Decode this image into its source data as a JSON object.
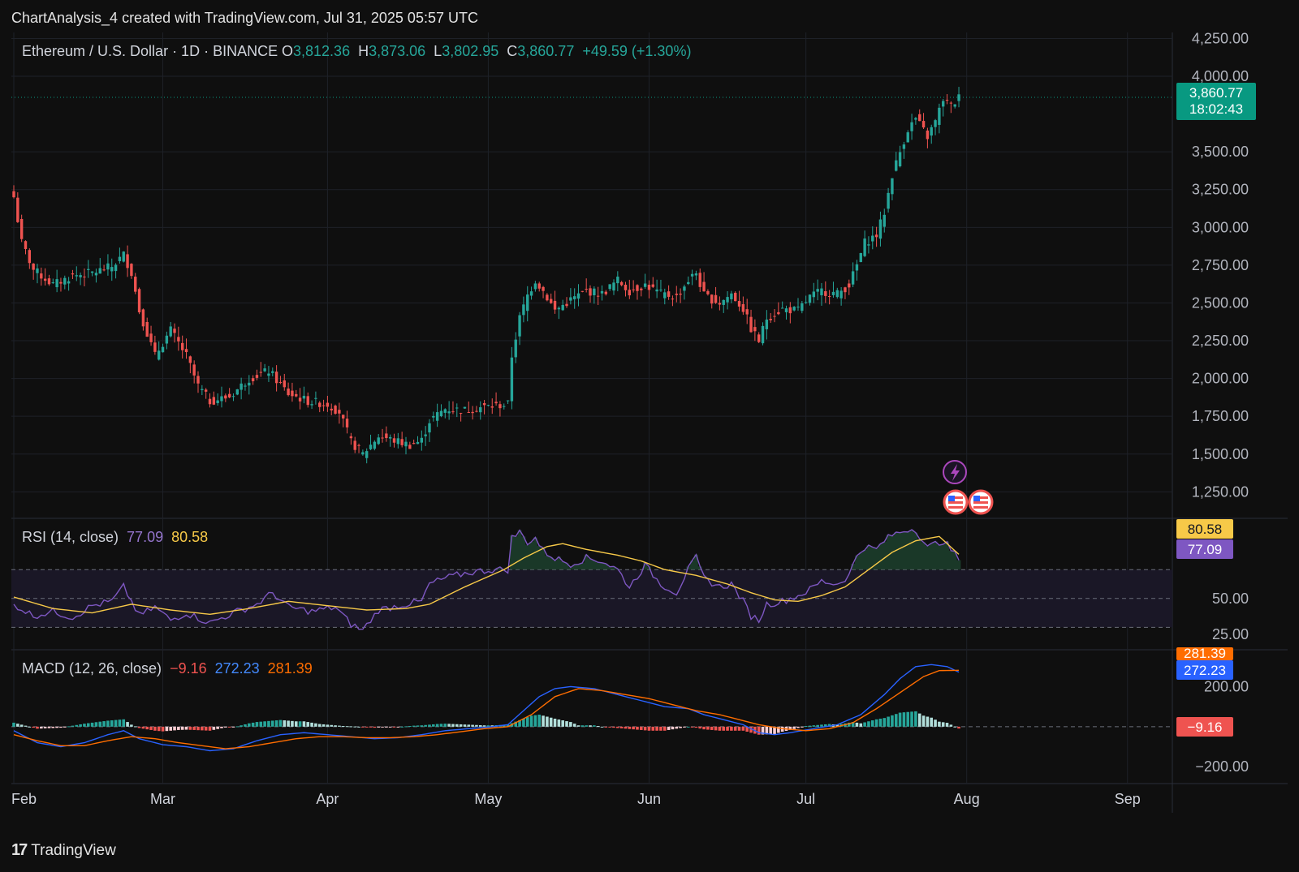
{
  "header": {
    "caption": "ChartAnalysis_4 created with TradingView.com, Jul 31, 2025 05:57 UTC"
  },
  "legend": {
    "symbol": "Ethereum / U.S. Dollar · 1D · BINANCE",
    "o_label": "O",
    "o_value": "3,812.36",
    "h_label": "H",
    "h_value": "3,873.06",
    "l_label": "L",
    "l_value": "3,802.95",
    "c_label": "C",
    "c_value": "3,860.77",
    "change": "+49.59 (+1.30%)"
  },
  "price_tag": {
    "price": "3,860.77",
    "countdown": "18:02:43"
  },
  "rsi": {
    "title": "RSI (14, close)",
    "value": "77.09",
    "ma_value": "80.58"
  },
  "macd": {
    "title": "MACD (12, 26, close)",
    "hist_value": "−9.16",
    "macd_value": "272.23",
    "signal_value": "281.39"
  },
  "footer": {
    "brand": "TradingView"
  },
  "colors": {
    "up": "#26a69a",
    "down": "#ef5350",
    "rsi_line": "#7e57c2",
    "rsi_ma": "#f7c948",
    "macd_line": "#2962ff",
    "signal_line": "#ff6d00",
    "tag_green": "#089981"
  },
  "chart_data": [
    {
      "type": "candlestick",
      "title": "Ethereum / U.S. Dollar · 1D · BINANCE",
      "x_ticks": [
        "Feb",
        "Mar",
        "Apr",
        "May",
        "Jun",
        "Jul",
        "Aug",
        "Sep"
      ],
      "y_ticks": [
        "1,250.00",
        "1,500.00",
        "1,750.00",
        "2,000.00",
        "2,250.00",
        "2,500.00",
        "2,750.00",
        "3,000.00",
        "3,250.00",
        "3,500.00",
        "4,000.00",
        "4,250.00"
      ],
      "ylim": [
        1080,
        4290
      ],
      "last_close": 3860.77,
      "anchors": [
        [
          0,
          3200
        ],
        [
          2,
          2900
        ],
        [
          5,
          2720
        ],
        [
          10,
          2620
        ],
        [
          15,
          2680
        ],
        [
          20,
          2700
        ],
        [
          25,
          2740
        ],
        [
          28,
          2820
        ],
        [
          30,
          2700
        ],
        [
          32,
          2450
        ],
        [
          36,
          2150
        ],
        [
          40,
          2320
        ],
        [
          44,
          2150
        ],
        [
          47,
          1950
        ],
        [
          50,
          1850
        ],
        [
          55,
          1880
        ],
        [
          60,
          2000
        ],
        [
          65,
          2050
        ],
        [
          70,
          1900
        ],
        [
          75,
          1850
        ],
        [
          80,
          1830
        ],
        [
          83,
          1780
        ],
        [
          86,
          1580
        ],
        [
          89,
          1500
        ],
        [
          93,
          1620
        ],
        [
          97,
          1590
        ],
        [
          101,
          1560
        ],
        [
          104,
          1590
        ],
        [
          106,
          1720
        ],
        [
          110,
          1800
        ],
        [
          115,
          1790
        ],
        [
          119,
          1810
        ],
        [
          123,
          1820
        ],
        [
          126,
          1830
        ],
        [
          127,
          2150
        ],
        [
          129,
          2400
        ],
        [
          131,
          2550
        ],
        [
          133,
          2650
        ],
        [
          135,
          2580
        ],
        [
          138,
          2450
        ],
        [
          142,
          2520
        ],
        [
          146,
          2580
        ],
        [
          150,
          2560
        ],
        [
          154,
          2650
        ],
        [
          157,
          2580
        ],
        [
          161,
          2620
        ],
        [
          165,
          2560
        ],
        [
          169,
          2540
        ],
        [
          172,
          2650
        ],
        [
          174,
          2700
        ],
        [
          176,
          2550
        ],
        [
          180,
          2500
        ],
        [
          183,
          2560
        ],
        [
          186,
          2460
        ],
        [
          188,
          2330
        ],
        [
          190,
          2250
        ],
        [
          192,
          2400
        ],
        [
          196,
          2460
        ],
        [
          200,
          2450
        ],
        [
          203,
          2540
        ],
        [
          206,
          2580
        ],
        [
          210,
          2560
        ],
        [
          213,
          2620
        ],
        [
          215,
          2750
        ],
        [
          217,
          2900
        ],
        [
          220,
          2950
        ],
        [
          222,
          3100
        ],
        [
          224,
          3350
        ],
        [
          226,
          3500
        ],
        [
          228,
          3650
        ],
        [
          230,
          3720
        ],
        [
          233,
          3600
        ],
        [
          235,
          3700
        ],
        [
          237,
          3850
        ],
        [
          239,
          3800
        ],
        [
          241,
          3860.77
        ]
      ],
      "candle_count": 242
    },
    {
      "type": "line",
      "title": "RSI (14, close)",
      "series": [
        {
          "name": "RSI",
          "anchors": [
            [
              0,
              46
            ],
            [
              5,
              38
            ],
            [
              10,
              41
            ],
            [
              15,
              37
            ],
            [
              20,
              45
            ],
            [
              25,
              48
            ],
            [
              28,
              58
            ],
            [
              32,
              38
            ],
            [
              36,
              44
            ],
            [
              40,
              35
            ],
            [
              44,
              40
            ],
            [
              50,
              33
            ],
            [
              56,
              40
            ],
            [
              62,
              46
            ],
            [
              66,
              54
            ],
            [
              70,
              44
            ],
            [
              76,
              41
            ],
            [
              82,
              44
            ],
            [
              86,
              32
            ],
            [
              89,
              28
            ],
            [
              93,
              42
            ],
            [
              98,
              45
            ],
            [
              104,
              48
            ],
            [
              106,
              60
            ],
            [
              110,
              64
            ],
            [
              116,
              68
            ],
            [
              122,
              70
            ],
            [
              126,
              70
            ],
            [
              127,
              92
            ],
            [
              129,
              96
            ],
            [
              131,
              89
            ],
            [
              133,
              92
            ],
            [
              135,
              83
            ],
            [
              138,
              78
            ],
            [
              142,
              74
            ],
            [
              146,
              78
            ],
            [
              150,
              76
            ],
            [
              154,
              70
            ],
            [
              157,
              58
            ],
            [
              161,
              73
            ],
            [
              165,
              60
            ],
            [
              169,
              54
            ],
            [
              172,
              70
            ],
            [
              174,
              78
            ],
            [
              176,
              64
            ],
            [
              180,
              58
            ],
            [
              183,
              60
            ],
            [
              186,
              48
            ],
            [
              188,
              38
            ],
            [
              190,
              35
            ],
            [
              192,
              46
            ],
            [
              196,
              48
            ],
            [
              200,
              52
            ],
            [
              203,
              56
            ],
            [
              206,
              62
            ],
            [
              210,
              60
            ],
            [
              213,
              66
            ],
            [
              215,
              80
            ],
            [
              217,
              86
            ],
            [
              220,
              84
            ],
            [
              222,
              90
            ],
            [
              224,
              94
            ],
            [
              226,
              96
            ],
            [
              228,
              98
            ],
            [
              230,
              98
            ],
            [
              233,
              85
            ],
            [
              235,
              88
            ],
            [
              237,
              90
            ],
            [
              239,
              84
            ],
            [
              241,
              77.09
            ]
          ]
        },
        {
          "name": "RSI-based MA",
          "anchors": [
            [
              0,
              51
            ],
            [
              10,
              43
            ],
            [
              20,
              40
            ],
            [
              30,
              46
            ],
            [
              40,
              42
            ],
            [
              50,
              39
            ],
            [
              60,
              43
            ],
            [
              70,
              48
            ],
            [
              80,
              45
            ],
            [
              90,
              42
            ],
            [
              100,
              43
            ],
            [
              106,
              46
            ],
            [
              115,
              58
            ],
            [
              125,
              70
            ],
            [
              130,
              78
            ],
            [
              136,
              86
            ],
            [
              140,
              88
            ],
            [
              146,
              84
            ],
            [
              154,
              80
            ],
            [
              160,
              76
            ],
            [
              166,
              70
            ],
            [
              174,
              66
            ],
            [
              182,
              60
            ],
            [
              188,
              54
            ],
            [
              194,
              49
            ],
            [
              200,
              48
            ],
            [
              206,
              52
            ],
            [
              212,
              58
            ],
            [
              218,
              70
            ],
            [
              224,
              82
            ],
            [
              230,
              90
            ],
            [
              236,
              93
            ],
            [
              241,
              80.58
            ]
          ]
        }
      ],
      "y_ticks": [
        "25.00",
        "50.00"
      ],
      "ylim": [
        15,
        105
      ],
      "bands": [
        30,
        50,
        70
      ]
    },
    {
      "type": "line",
      "title": "MACD (12, 26, close)",
      "series": [
        {
          "name": "MACD",
          "anchors": [
            [
              0,
              -20
            ],
            [
              6,
              -80
            ],
            [
              12,
              -100
            ],
            [
              18,
              -80
            ],
            [
              24,
              -40
            ],
            [
              28,
              -20
            ],
            [
              32,
              -60
            ],
            [
              38,
              -90
            ],
            [
              44,
              -100
            ],
            [
              50,
              -120
            ],
            [
              56,
              -110
            ],
            [
              62,
              -70
            ],
            [
              68,
              -40
            ],
            [
              74,
              -30
            ],
            [
              80,
              -40
            ],
            [
              86,
              -50
            ],
            [
              92,
              -60
            ],
            [
              98,
              -55
            ],
            [
              104,
              -40
            ],
            [
              110,
              -20
            ],
            [
              116,
              -10
            ],
            [
              122,
              0
            ],
            [
              126,
              10
            ],
            [
              130,
              80
            ],
            [
              134,
              150
            ],
            [
              138,
              190
            ],
            [
              142,
              200
            ],
            [
              148,
              190
            ],
            [
              154,
              160
            ],
            [
              160,
              130
            ],
            [
              166,
              100
            ],
            [
              172,
              90
            ],
            [
              176,
              60
            ],
            [
              182,
              30
            ],
            [
              186,
              10
            ],
            [
              190,
              -30
            ],
            [
              194,
              -40
            ],
            [
              198,
              -30
            ],
            [
              204,
              -10
            ],
            [
              210,
              10
            ],
            [
              216,
              60
            ],
            [
              222,
              160
            ],
            [
              226,
              240
            ],
            [
              230,
              300
            ],
            [
              234,
              310
            ],
            [
              238,
              300
            ],
            [
              241,
              272.23
            ]
          ]
        },
        {
          "name": "Signal",
          "anchors": [
            [
              0,
              -40
            ],
            [
              6,
              -70
            ],
            [
              12,
              -95
            ],
            [
              18,
              -95
            ],
            [
              24,
              -70
            ],
            [
              30,
              -50
            ],
            [
              36,
              -60
            ],
            [
              42,
              -80
            ],
            [
              48,
              -95
            ],
            [
              54,
              -110
            ],
            [
              60,
              -100
            ],
            [
              66,
              -80
            ],
            [
              72,
              -60
            ],
            [
              78,
              -50
            ],
            [
              84,
              -50
            ],
            [
              90,
              -55
            ],
            [
              96,
              -55
            ],
            [
              102,
              -50
            ],
            [
              108,
              -40
            ],
            [
              114,
              -25
            ],
            [
              120,
              -10
            ],
            [
              126,
              0
            ],
            [
              132,
              60
            ],
            [
              138,
              150
            ],
            [
              144,
              190
            ],
            [
              150,
              180
            ],
            [
              156,
              160
            ],
            [
              162,
              140
            ],
            [
              168,
              110
            ],
            [
              174,
              80
            ],
            [
              180,
              60
            ],
            [
              186,
              30
            ],
            [
              190,
              10
            ],
            [
              196,
              -10
            ],
            [
              202,
              -20
            ],
            [
              208,
              -10
            ],
            [
              214,
              20
            ],
            [
              220,
              90
            ],
            [
              226,
              170
            ],
            [
              232,
              250
            ],
            [
              236,
              280
            ],
            [
              241,
              281.39
            ]
          ]
        }
      ],
      "y_ticks": [
        "200.00",
        "−200.00"
      ],
      "ylim": [
        -280,
        380
      ]
    }
  ]
}
